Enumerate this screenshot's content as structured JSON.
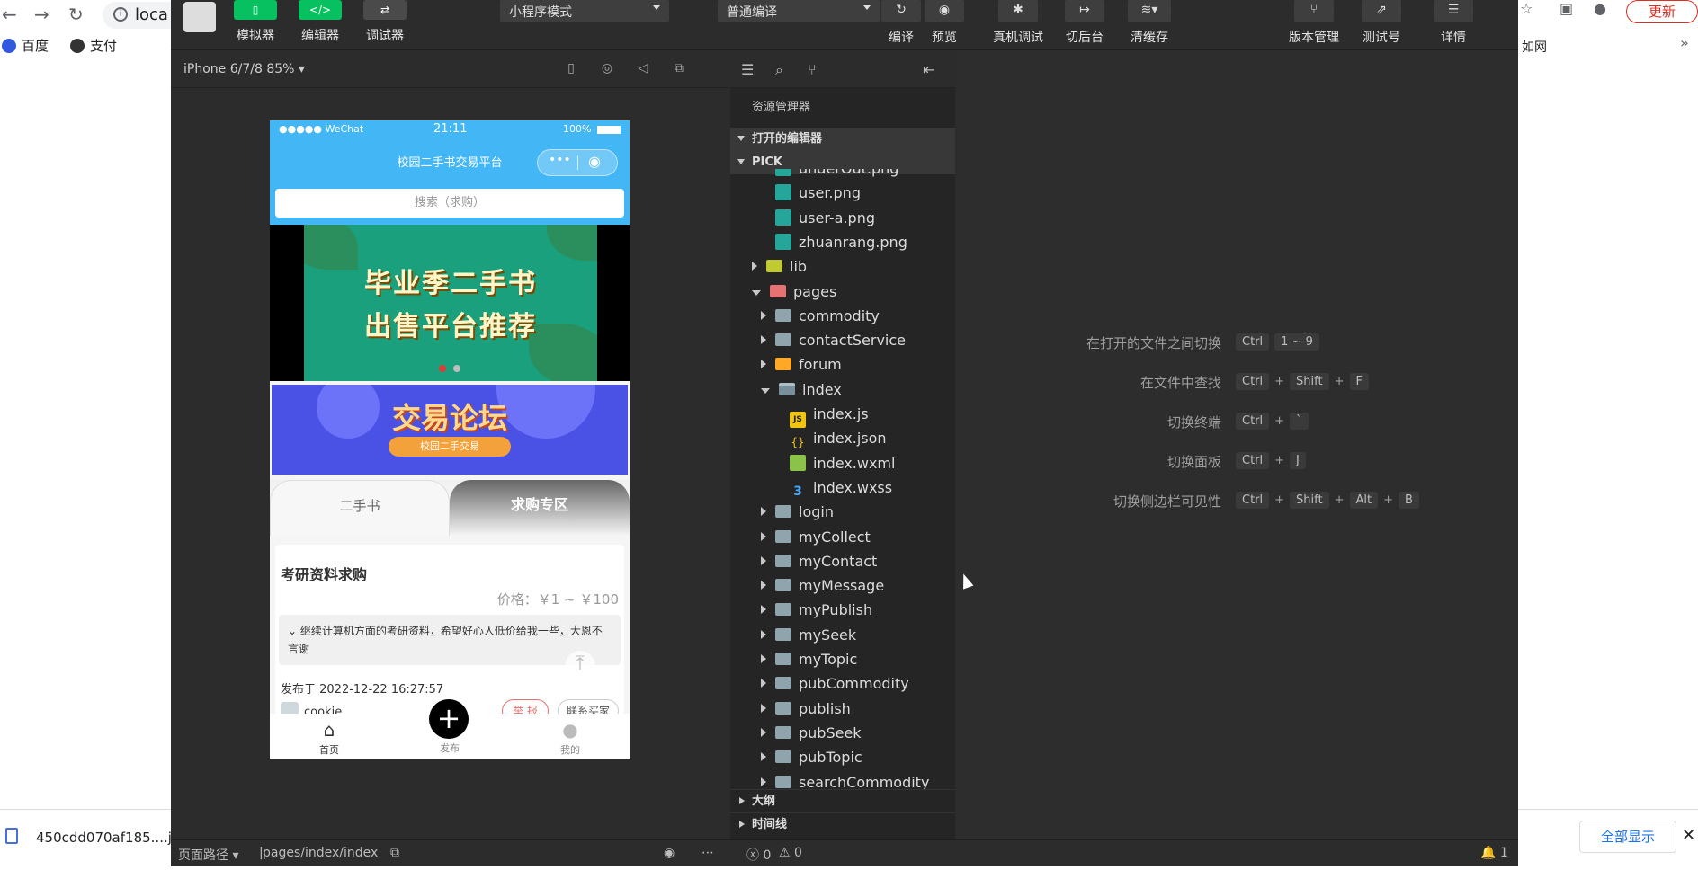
{
  "browser": {
    "url": "loca",
    "bookmarks": [
      "百度",
      "支付"
    ],
    "update_label": "更新",
    "right_tail": "如网",
    "download_name": "450cdd070af185....j",
    "show_all": "全部显示"
  },
  "toolbar": {
    "simulator": "模拟器",
    "editor": "编辑器",
    "debugger": "调试器",
    "mode_select": "小程序模式",
    "compile_select": "普通编译",
    "compile": "编译",
    "preview": "预览",
    "real_debug": "真机调试",
    "cut_back": "切后台",
    "clear_cache": "清缓存",
    "version": "版本管理",
    "test_id": "测试号",
    "details": "详情"
  },
  "simulator": {
    "device": "iPhone 6/7/8 85%",
    "status_left": "●●●●● WeChat",
    "status_time": "21:11",
    "status_battery": "100%",
    "nav_title": "校园二手书交易平台",
    "search_placeholder": "搜索（求购）",
    "banner_line1": "毕业季二手书",
    "banner_line2": "出售平台推荐",
    "forum_title": "交易论坛",
    "forum_sub": "校园二手交易",
    "tab_secondhand": "二手书",
    "tab_seek": "求购专区",
    "card_title": "考研资料求购",
    "card_price": "价格：￥1 ~ ￥100",
    "card_desc": "继续计算机方面的考研资料，希望好心人低价给我一些，大恩不言谢",
    "card_time": "发布于 2022-12-22 16:27:57",
    "card_user": "cookie",
    "report": "举 报",
    "contact": "联系买家",
    "tab_home": "首页",
    "tab_publish": "发布",
    "tab_mine": "我的"
  },
  "explorer": {
    "title": "资源管理器",
    "open_editors": "打开的编辑器",
    "project": "PICK",
    "outline": "大纲",
    "timeline": "时间线",
    "tree": [
      {
        "label": "underOut.png",
        "type": "img",
        "depth": 2
      },
      {
        "label": "user.png",
        "type": "img",
        "depth": 2
      },
      {
        "label": "user-a.png",
        "type": "img",
        "depth": 2
      },
      {
        "label": "zhuanrang.png",
        "type": "img",
        "depth": 2
      },
      {
        "label": "lib",
        "type": "folder-lib",
        "depth": 1,
        "arrow": "r"
      },
      {
        "label": "pages",
        "type": "folder-pages",
        "depth": 1,
        "arrow": "d"
      },
      {
        "label": "commodity",
        "type": "folder",
        "depth": 2,
        "arrow": "r"
      },
      {
        "label": "contactService",
        "type": "folder",
        "depth": 2,
        "arrow": "r"
      },
      {
        "label": "forum",
        "type": "folder-forum",
        "depth": 2,
        "arrow": "r"
      },
      {
        "label": "index",
        "type": "folder-open",
        "depth": 2,
        "arrow": "d"
      },
      {
        "label": "index.js",
        "type": "js",
        "depth": 3
      },
      {
        "label": "index.json",
        "type": "json",
        "depth": 3
      },
      {
        "label": "index.wxml",
        "type": "wxml",
        "depth": 3
      },
      {
        "label": "index.wxss",
        "type": "wxss",
        "depth": 3
      },
      {
        "label": "login",
        "type": "folder",
        "depth": 2,
        "arrow": "r"
      },
      {
        "label": "myCollect",
        "type": "folder",
        "depth": 2,
        "arrow": "r"
      },
      {
        "label": "myContact",
        "type": "folder",
        "depth": 2,
        "arrow": "r"
      },
      {
        "label": "myMessage",
        "type": "folder",
        "depth": 2,
        "arrow": "r"
      },
      {
        "label": "myPublish",
        "type": "folder",
        "depth": 2,
        "arrow": "r"
      },
      {
        "label": "mySeek",
        "type": "folder",
        "depth": 2,
        "arrow": "r"
      },
      {
        "label": "myTopic",
        "type": "folder",
        "depth": 2,
        "arrow": "r"
      },
      {
        "label": "pubCommodity",
        "type": "folder",
        "depth": 2,
        "arrow": "r"
      },
      {
        "label": "publish",
        "type": "folder",
        "depth": 2,
        "arrow": "r"
      },
      {
        "label": "pubSeek",
        "type": "folder",
        "depth": 2,
        "arrow": "r"
      },
      {
        "label": "pubTopic",
        "type": "folder",
        "depth": 2,
        "arrow": "r"
      },
      {
        "label": "searchCommodity",
        "type": "folder",
        "depth": 2,
        "arrow": "r"
      }
    ]
  },
  "editor": {
    "shortcuts": [
      {
        "label": "在打开的文件之间切换",
        "keys": [
          "Ctrl",
          "1 ~ 9"
        ]
      },
      {
        "label": "在文件中查找",
        "keys": [
          "Ctrl",
          "+",
          "Shift",
          "+",
          "F"
        ]
      },
      {
        "label": "切换终端",
        "keys": [
          "Ctrl",
          "+",
          "`"
        ]
      },
      {
        "label": "切换面板",
        "keys": [
          "Ctrl",
          "+",
          "J"
        ]
      },
      {
        "label": "切换侧边栏可见性",
        "keys": [
          "Ctrl",
          "+",
          "Shift",
          "+",
          "Alt",
          "+",
          "B"
        ]
      }
    ]
  },
  "statusbar": {
    "page_path_label": "页面路径",
    "page_path": "pages/index/index",
    "errors": "0",
    "warnings": "0",
    "notifications": "1"
  }
}
